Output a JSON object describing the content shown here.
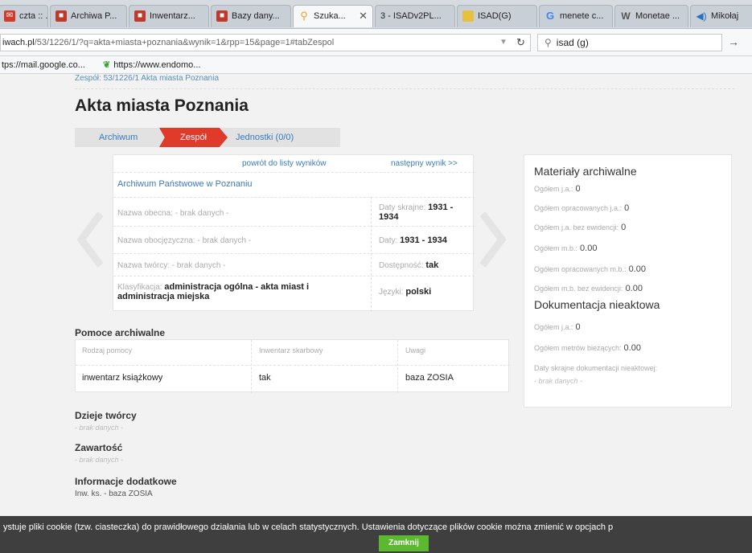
{
  "browser": {
    "tabs": [
      {
        "label": "czta :: ...",
        "icon": "mail-icon",
        "color": "#d43a2a"
      },
      {
        "label": "Archiwa P...",
        "icon": "archive-icon",
        "color": "#c0392b"
      },
      {
        "label": "Inwentarz...",
        "icon": "archive-icon",
        "color": "#c0392b"
      },
      {
        "label": "Bazy dany...",
        "icon": "archive-icon",
        "color": "#c0392b"
      },
      {
        "label": "Szuka...",
        "icon": "search-icon",
        "color": "#f0a020"
      },
      {
        "label": "3 - ISADv2PL...",
        "icon": "page-icon",
        "color": "#888888"
      },
      {
        "label": "ISAD(G)",
        "icon": "folder-icon",
        "color": "#e8c040"
      },
      {
        "label": "menete c...",
        "icon": "google-icon",
        "color": "#4285f4"
      },
      {
        "label": "Monetae ...",
        "icon": "wikipedia-icon",
        "color": "#555555"
      },
      {
        "label": "Mikołaj",
        "icon": "audio-icon",
        "color": "#2a70c0"
      }
    ],
    "url_prefix": "iwach.pl",
    "url_rest": "/53/1226/1/?q=akta+miasta+poznania&wynik=1&rpp=15&page=1#tabZespol",
    "search_value": "isad (g)",
    "bookmarks": [
      "tps://mail.google.co...",
      "https://www.endomo..."
    ]
  },
  "page": {
    "crumb": "Zespół: 53/1226/1 Akta miasta Poznania",
    "title": "Akta miasta Poznania",
    "steps": {
      "archive": "Archiwum",
      "fonds": "Zespół",
      "units": "Jednostki (0/0)"
    },
    "nav": {
      "back": "powrót do listy wyników",
      "next": "następny wynik >>"
    },
    "archive_name": "Archiwum Państwowe w Poznaniu",
    "fields": {
      "current_name_label": "Nazwa obecna:",
      "current_name_value": "- brak danych -",
      "date_label": "Daty skrajne:",
      "date_value": "1931 - 1934",
      "other_name_label": "Nazwa obocjęzyczna:",
      "other_name_value": "- brak danych -",
      "dates_label": "Daty:",
      "dates_value": "1931 - 1934",
      "creator_label": "Nazwa twórcy:",
      "creator_value": "- brak danych -",
      "access_label": "Dostępność:",
      "access_value": "tak",
      "class_label": "Klasyfikacja:",
      "class_value": "administracja ogólna - akta miast i administracja miejska",
      "lang_label": "Języki:",
      "lang_value": "polski"
    },
    "aids": {
      "heading": "Pomoce archiwalne",
      "headers": [
        "Rodzaj pomocy",
        "Inwentarz skarbowy",
        "Uwagi"
      ],
      "row": [
        "inwentarz książkowy",
        "tak",
        "baza ZOSIA"
      ]
    },
    "history": {
      "heading": "Dzieje twórcy",
      "value": "- brak danych -"
    },
    "content": {
      "heading": "Zawartość",
      "value": "- brak danych -"
    },
    "additional": {
      "heading": "Informacje dodatkowe",
      "value": "Inw. ks. - baza ZOSIA"
    },
    "side": {
      "h1": "Materiały archiwalne",
      "rows1": [
        {
          "label": "Ogółem j.a.:",
          "value": "0"
        },
        {
          "label": "Ogółem opracowanych j.a.:",
          "value": "0"
        },
        {
          "label": "Ogółem j.a. bez ewidencji:",
          "value": "0"
        },
        {
          "label": "Ogółem m.b.:",
          "value": "0.00"
        },
        {
          "label": "Ogółem opracowanych m.b.:",
          "value": "0.00"
        },
        {
          "label": "Ogółem m.b. bez ewidencji:",
          "value": "0.00"
        }
      ],
      "h2": "Dokumentacja nieaktowa",
      "rows2": [
        {
          "label": "Ogółem j.a.:",
          "value": "0"
        },
        {
          "label": "Ogółem metrów bieżących:",
          "value": "0.00"
        }
      ],
      "dates_label": "Daty skrajne dokumentacji nieaktowej:",
      "dates_value": "- brak danych -"
    }
  },
  "cookie": {
    "text": "ystuje pliki cookie (tzw. ciasteczka) do prawidłowego działania lub w celach statystycznych. Ustawienia dotyczące plików cookie można zmienić w opcjach p",
    "button": "Zamknij"
  },
  "colors": {
    "accent_red": "#e03a2a",
    "link_blue": "#3a7ab8",
    "accept_green": "#5cb82f"
  }
}
